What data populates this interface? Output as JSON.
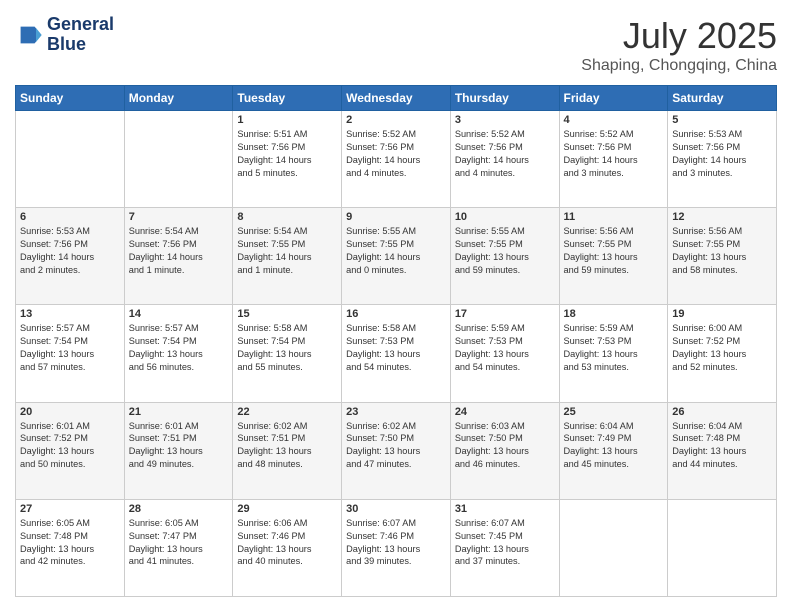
{
  "header": {
    "logo_line1": "General",
    "logo_line2": "Blue",
    "month": "July 2025",
    "location": "Shaping, Chongqing, China"
  },
  "weekdays": [
    "Sunday",
    "Monday",
    "Tuesday",
    "Wednesday",
    "Thursday",
    "Friday",
    "Saturday"
  ],
  "weeks": [
    [
      {
        "day": "",
        "info": ""
      },
      {
        "day": "",
        "info": ""
      },
      {
        "day": "1",
        "info": "Sunrise: 5:51 AM\nSunset: 7:56 PM\nDaylight: 14 hours\nand 5 minutes."
      },
      {
        "day": "2",
        "info": "Sunrise: 5:52 AM\nSunset: 7:56 PM\nDaylight: 14 hours\nand 4 minutes."
      },
      {
        "day": "3",
        "info": "Sunrise: 5:52 AM\nSunset: 7:56 PM\nDaylight: 14 hours\nand 4 minutes."
      },
      {
        "day": "4",
        "info": "Sunrise: 5:52 AM\nSunset: 7:56 PM\nDaylight: 14 hours\nand 3 minutes."
      },
      {
        "day": "5",
        "info": "Sunrise: 5:53 AM\nSunset: 7:56 PM\nDaylight: 14 hours\nand 3 minutes."
      }
    ],
    [
      {
        "day": "6",
        "info": "Sunrise: 5:53 AM\nSunset: 7:56 PM\nDaylight: 14 hours\nand 2 minutes."
      },
      {
        "day": "7",
        "info": "Sunrise: 5:54 AM\nSunset: 7:56 PM\nDaylight: 14 hours\nand 1 minute."
      },
      {
        "day": "8",
        "info": "Sunrise: 5:54 AM\nSunset: 7:55 PM\nDaylight: 14 hours\nand 1 minute."
      },
      {
        "day": "9",
        "info": "Sunrise: 5:55 AM\nSunset: 7:55 PM\nDaylight: 14 hours\nand 0 minutes."
      },
      {
        "day": "10",
        "info": "Sunrise: 5:55 AM\nSunset: 7:55 PM\nDaylight: 13 hours\nand 59 minutes."
      },
      {
        "day": "11",
        "info": "Sunrise: 5:56 AM\nSunset: 7:55 PM\nDaylight: 13 hours\nand 59 minutes."
      },
      {
        "day": "12",
        "info": "Sunrise: 5:56 AM\nSunset: 7:55 PM\nDaylight: 13 hours\nand 58 minutes."
      }
    ],
    [
      {
        "day": "13",
        "info": "Sunrise: 5:57 AM\nSunset: 7:54 PM\nDaylight: 13 hours\nand 57 minutes."
      },
      {
        "day": "14",
        "info": "Sunrise: 5:57 AM\nSunset: 7:54 PM\nDaylight: 13 hours\nand 56 minutes."
      },
      {
        "day": "15",
        "info": "Sunrise: 5:58 AM\nSunset: 7:54 PM\nDaylight: 13 hours\nand 55 minutes."
      },
      {
        "day": "16",
        "info": "Sunrise: 5:58 AM\nSunset: 7:53 PM\nDaylight: 13 hours\nand 54 minutes."
      },
      {
        "day": "17",
        "info": "Sunrise: 5:59 AM\nSunset: 7:53 PM\nDaylight: 13 hours\nand 54 minutes."
      },
      {
        "day": "18",
        "info": "Sunrise: 5:59 AM\nSunset: 7:53 PM\nDaylight: 13 hours\nand 53 minutes."
      },
      {
        "day": "19",
        "info": "Sunrise: 6:00 AM\nSunset: 7:52 PM\nDaylight: 13 hours\nand 52 minutes."
      }
    ],
    [
      {
        "day": "20",
        "info": "Sunrise: 6:01 AM\nSunset: 7:52 PM\nDaylight: 13 hours\nand 50 minutes."
      },
      {
        "day": "21",
        "info": "Sunrise: 6:01 AM\nSunset: 7:51 PM\nDaylight: 13 hours\nand 49 minutes."
      },
      {
        "day": "22",
        "info": "Sunrise: 6:02 AM\nSunset: 7:51 PM\nDaylight: 13 hours\nand 48 minutes."
      },
      {
        "day": "23",
        "info": "Sunrise: 6:02 AM\nSunset: 7:50 PM\nDaylight: 13 hours\nand 47 minutes."
      },
      {
        "day": "24",
        "info": "Sunrise: 6:03 AM\nSunset: 7:50 PM\nDaylight: 13 hours\nand 46 minutes."
      },
      {
        "day": "25",
        "info": "Sunrise: 6:04 AM\nSunset: 7:49 PM\nDaylight: 13 hours\nand 45 minutes."
      },
      {
        "day": "26",
        "info": "Sunrise: 6:04 AM\nSunset: 7:48 PM\nDaylight: 13 hours\nand 44 minutes."
      }
    ],
    [
      {
        "day": "27",
        "info": "Sunrise: 6:05 AM\nSunset: 7:48 PM\nDaylight: 13 hours\nand 42 minutes."
      },
      {
        "day": "28",
        "info": "Sunrise: 6:05 AM\nSunset: 7:47 PM\nDaylight: 13 hours\nand 41 minutes."
      },
      {
        "day": "29",
        "info": "Sunrise: 6:06 AM\nSunset: 7:46 PM\nDaylight: 13 hours\nand 40 minutes."
      },
      {
        "day": "30",
        "info": "Sunrise: 6:07 AM\nSunset: 7:46 PM\nDaylight: 13 hours\nand 39 minutes."
      },
      {
        "day": "31",
        "info": "Sunrise: 6:07 AM\nSunset: 7:45 PM\nDaylight: 13 hours\nand 37 minutes."
      },
      {
        "day": "",
        "info": ""
      },
      {
        "day": "",
        "info": ""
      }
    ]
  ]
}
